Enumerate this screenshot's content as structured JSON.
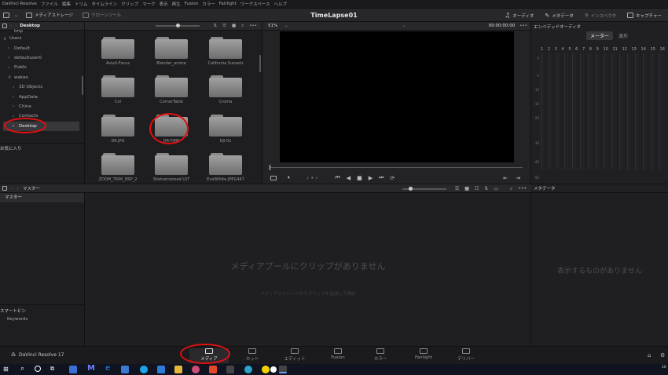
{
  "menu": {
    "items": [
      "DaVinci Resolve",
      "ファイル",
      "編集",
      "トリム",
      "タイムライン",
      "クリップ",
      "マーク",
      "表示",
      "再生",
      "Fusion",
      "カラー",
      "Fairlight",
      "ワークスペース",
      "ヘルプ"
    ]
  },
  "toolbar": {
    "media_storage": "メディアストレージ",
    "clone_tool": "クローンツール",
    "title": "TimeLapse01",
    "audio": "オーディオ",
    "metadata": "メタデータ",
    "inspector": "インスペクタ",
    "capture": "キャプチャー"
  },
  "storage": {
    "location": "Desktop",
    "tree": [
      {
        "label": "tmp",
        "chev": ""
      },
      {
        "label": "Users",
        "chev": "∨"
      },
      {
        "label": "Default",
        "chev": "›"
      },
      {
        "label": "defaultuser0",
        "chev": "›"
      },
      {
        "label": "Public",
        "chev": "›"
      },
      {
        "label": "wakao",
        "chev": "∨"
      },
      {
        "label": "3D Objects",
        "chev": "›"
      },
      {
        "label": "AppData",
        "chev": "›"
      },
      {
        "label": "China",
        "chev": "›"
      },
      {
        "label": "Contacts",
        "chev": "›"
      },
      {
        "label": "Desktop",
        "chev": "›"
      }
    ],
    "favorites": "お気に入り"
  },
  "browser": {
    "folders": [
      "Aviutl-Focus",
      "Blender_anime",
      "California Sunsets",
      "Col",
      "CornerTable",
      "Croma",
      "DR.JPG",
      "DR-TIME",
      "DJI-01",
      "ZOOM_TRIM_DRP_2",
      "Shotversioned LST",
      "EvolWhite.JPEG447"
    ]
  },
  "viewer": {
    "zoom": "51%",
    "timecode": "00:00:00:00"
  },
  "audio_panel": {
    "title": "エンベデッドオーディオ",
    "tab_meter": "メーター",
    "tab_wave": "波形",
    "channels": [
      "1",
      "2",
      "3",
      "4",
      "5",
      "6",
      "7",
      "8",
      "9",
      "10",
      "11",
      "12",
      "13",
      "14",
      "15",
      "16"
    ],
    "scale": [
      "0",
      "-5",
      "-10",
      "-15",
      "-20",
      "-30",
      "-40",
      "-50"
    ]
  },
  "pool": {
    "header": "マスター",
    "bin": "マスター",
    "empty": "メディアプールにクリップがありません",
    "hint": "メディアストレージからクリップを追加して開始",
    "smart_bins": "スマートビン",
    "keywords": "Keywords"
  },
  "metadata_panel": {
    "title": "メタデータ",
    "empty": "表示するものがありません"
  },
  "pages": {
    "app_name": "DaVinci Resolve 17",
    "items": [
      "メディア",
      "カット",
      "エディット",
      "Fusion",
      "カラー",
      "Fairlight",
      "デリバー"
    ]
  },
  "taskbar": {
    "time": "10"
  },
  "colors": {
    "annotation": "#e01010",
    "active_page": "#c7c7c7"
  }
}
